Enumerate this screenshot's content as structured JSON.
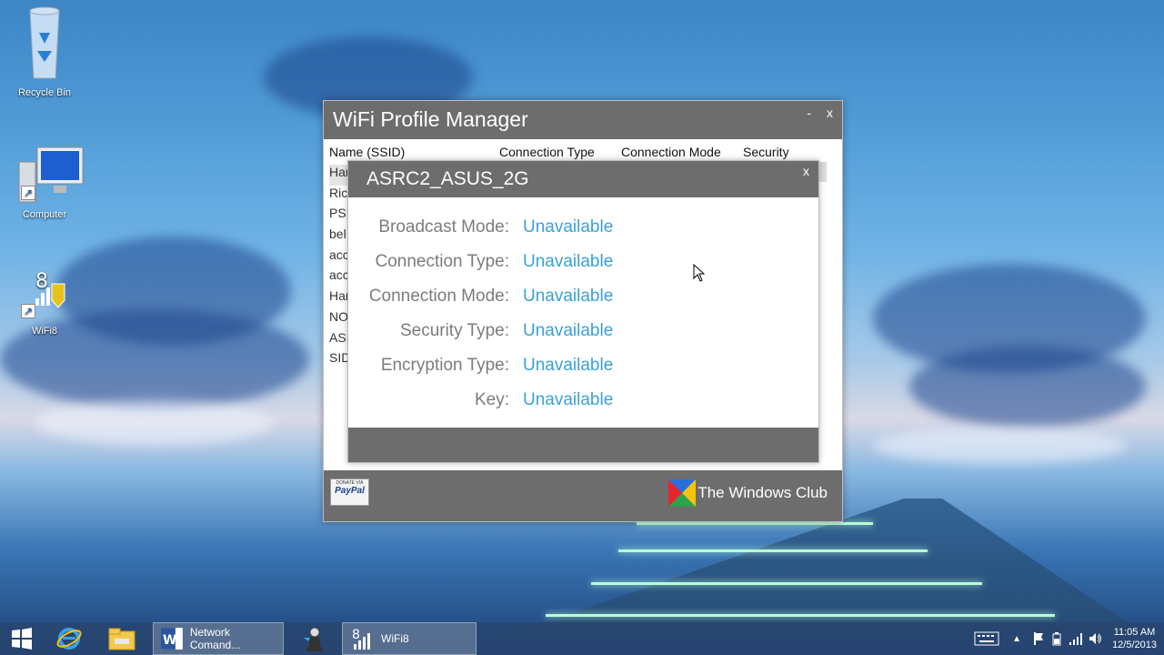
{
  "desktop": {
    "icons": [
      {
        "label": "Recycle Bin",
        "icon": "recycle-bin-icon"
      },
      {
        "label": "Computer",
        "icon": "computer-icon"
      },
      {
        "label": "WiFi8",
        "icon": "wifi8-icon"
      }
    ]
  },
  "window": {
    "title": "WiFi Profile Manager",
    "minimize_label": "-",
    "close_label": "x",
    "columns": [
      "Name (SSID)",
      "Connection Type",
      "Connection Mode",
      "Security"
    ],
    "profiles": [
      "Har",
      "Ric",
      "PSI",
      "bel",
      "acc",
      "acc",
      "Har",
      "NO",
      "ASI",
      "SID"
    ],
    "footer": {
      "paypal_small": "DONATE VIA",
      "paypal_brand": "PayPal",
      "brand_text": "The Windows Club"
    }
  },
  "dialog": {
    "title": "ASRC2_ASUS_2G",
    "close_label": "x",
    "fields": [
      {
        "label": "Broadcast Mode:",
        "value": "Unavailable"
      },
      {
        "label": "Connection Type:",
        "value": "Unavailable"
      },
      {
        "label": "Connection Mode:",
        "value": "Unavailable"
      },
      {
        "label": "Security Type:",
        "value": "Unavailable"
      },
      {
        "label": "Encryption Type:",
        "value": "Unavailable"
      },
      {
        "label": "Key:",
        "value": "Unavailable"
      }
    ],
    "value_color": "#3aa0d8"
  },
  "taskbar": {
    "items": [
      {
        "label": "",
        "icon": "start-icon"
      },
      {
        "label": "",
        "icon": "internet-explorer-icon"
      },
      {
        "label": "",
        "icon": "file-explorer-icon"
      },
      {
        "label": "Network Comand...",
        "icon": "word-icon"
      },
      {
        "label": "",
        "icon": "chess-icon"
      },
      {
        "label": "WiFi8",
        "icon": "wifi8-icon"
      }
    ],
    "time": "11:05 AM",
    "date": "12/5/2013"
  }
}
